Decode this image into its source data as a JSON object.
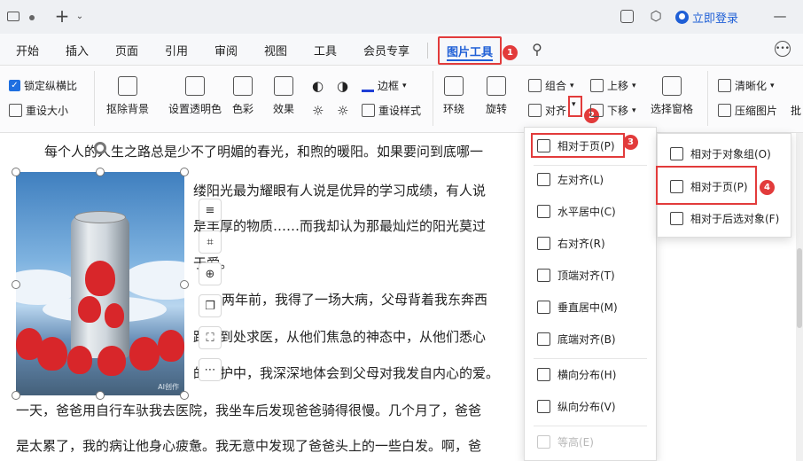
{
  "titlebar": {
    "login_label": "立即登录"
  },
  "menu": {
    "items": [
      "开始",
      "插入",
      "页面",
      "引用",
      "审阅",
      "视图",
      "工具",
      "会员专享"
    ],
    "active": "图片工具"
  },
  "ribbon": {
    "lock_ratio": "锁定纵横比",
    "reset_size": "重设大小",
    "remove_bg": "抠除背景",
    "set_transparent": "设置透明色",
    "color": "色彩",
    "effect": "效果",
    "border": "边框",
    "reset_style": "重设样式",
    "wrap": "环绕",
    "rotate": "旋转",
    "align": "对齐",
    "group": "组合",
    "move_up": "上移",
    "move_down": "下移",
    "select_pane": "选择窗格",
    "sharpen": "清晰化",
    "compress": "压缩图片",
    "batch": "批"
  },
  "document": {
    "lines": [
      "每个人的人生之路总是少不了明媚的春光，和煦的暖阳。如果要问到底哪一",
      "缕阳光最为耀眼有人说是优异的学习成绩，有人说",
      "是丰厚的物质……而我却认为那最灿烂的阳光莫过",
      "于爱。",
      "两年前，我得了一场大病，父母背着我东奔西",
      "跑，到处求医，从他们焦急的神态中，从他们悉心",
      "的呵护中，我深深地体会到父母对我发自内心的爱。",
      "一天，爸爸用自行车驮我去医院，我坐车后发现爸爸骑得很慢。几个月了，爸爸",
      "是太累了，我的病让他身心疲惫。我无意中发现了爸爸头上的一些白发。啊，爸"
    ],
    "image_watermark": "AI创作"
  },
  "align_menu": {
    "items": [
      "相对于页(P)",
      "左对齐(L)",
      "水平居中(C)",
      "右对齐(R)",
      "顶端对齐(T)",
      "垂直居中(M)",
      "底端对齐(B)",
      "横向分布(H)",
      "纵向分布(V)",
      "等高(E)"
    ]
  },
  "relative_menu": {
    "items": [
      "相对于对象组(O)",
      "相对于页(P)",
      "相对于后选对象(F)"
    ]
  },
  "badges": [
    "1",
    "2",
    "3",
    "4"
  ],
  "colors": {
    "accent": "#1f5fd6",
    "highlight_red": "#e23b3b"
  }
}
